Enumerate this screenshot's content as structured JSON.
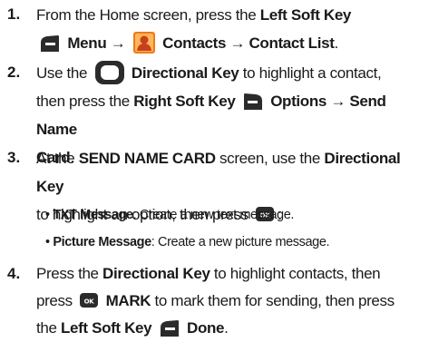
{
  "steps": [
    {
      "num": "1.",
      "line1_a": "From the Home screen, press the ",
      "line1_b": "Left Soft Key",
      "line2_a": "Menu",
      "arrow": "→",
      "line2_b": "Contacts",
      "line2_c": "Contact List",
      "line2_end": "."
    },
    {
      "num": "2.",
      "l1_a": "Use the ",
      "l1_b": "Directional Key",
      "l1_c": " to highlight a contact,",
      "l2_a": "then press the ",
      "l2_b": "Right Soft Key",
      "l2_c": "Options",
      "arrow": "→",
      "l2_d": "Send Name",
      "l3_a": "Card",
      "l3_b": "."
    },
    {
      "num": "3.",
      "l1_a": "At the ",
      "l1_b": "SEND NAME CARD",
      "l1_c": " screen, use the ",
      "l1_d": "Directional Key",
      "l2_a": "to highlight an option, then press ",
      "l2_b": ":",
      "bullets": [
        {
          "label": "TXT Message",
          "text": ": Create a new text message."
        },
        {
          "label": "Picture Message",
          "text": ": Create a new picture message."
        }
      ]
    },
    {
      "num": "4.",
      "l1_a": "Press the ",
      "l1_b": "Directional Key",
      "l1_c": " to highlight contacts, then",
      "l2_a": "press ",
      "l2_b": "MARK",
      "l2_c": " to mark them for sending, then press",
      "l3_a": "the ",
      "l3_b": "Left Soft Key",
      "l3_c": "Done",
      "l3_d": "."
    }
  ],
  "bullet_char": "•",
  "icons": {
    "left_soft_key": "left-soft-key-icon",
    "right_soft_key": "right-soft-key-icon",
    "contacts": "contacts-app-icon",
    "directional_key": "directional-key-icon",
    "ok_key": "ok-key-icon"
  },
  "colors": {
    "icon_dark": "#2b2b2b",
    "contacts_orange": "#f07a1a"
  }
}
